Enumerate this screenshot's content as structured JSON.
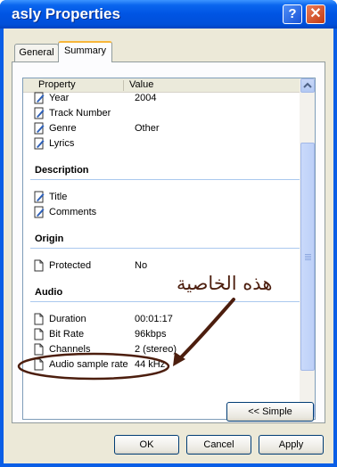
{
  "window": {
    "title": "asly Properties",
    "help_glyph": "?",
    "close_glyph": "✕"
  },
  "tabs": [
    {
      "label": "General"
    },
    {
      "label": "Summary"
    }
  ],
  "list": {
    "col_property": "Property",
    "col_value": "Value",
    "rows_top": [
      {
        "label": "Year",
        "value": "2004",
        "icon": "edit-icon"
      },
      {
        "label": "Track Number",
        "value": "",
        "icon": "edit-icon"
      },
      {
        "label": "Genre",
        "value": "Other",
        "icon": "edit-icon"
      },
      {
        "label": "Lyrics",
        "value": "",
        "icon": "edit-icon"
      }
    ],
    "groups": {
      "description": "Description",
      "origin": "Origin",
      "audio": "Audio"
    },
    "rows_description": [
      {
        "label": "Title",
        "value": "",
        "icon": "edit-icon"
      },
      {
        "label": "Comments",
        "value": "",
        "icon": "edit-icon"
      }
    ],
    "rows_origin": [
      {
        "label": "Protected",
        "value": "No",
        "icon": "document-icon"
      }
    ],
    "rows_audio": [
      {
        "label": "Duration",
        "value": "00:01:17",
        "icon": "document-icon"
      },
      {
        "label": "Bit Rate",
        "value": "96kbps",
        "icon": "document-icon"
      },
      {
        "label": "Channels",
        "value": "2 (stereo)",
        "icon": "document-icon"
      },
      {
        "label": "Audio sample rate",
        "value": "44 kHz",
        "icon": "document-icon"
      }
    ]
  },
  "annotation": {
    "text": "هذه الخاصية",
    "color": "#4c1e0e"
  },
  "buttons": {
    "simple": "<< Simple",
    "ok": "OK",
    "cancel": "Cancel",
    "apply": "Apply"
  },
  "colors": {
    "titlebar": "#0054e3",
    "dialog_bg": "#ece9d8",
    "group_line": "#aac8ee"
  }
}
